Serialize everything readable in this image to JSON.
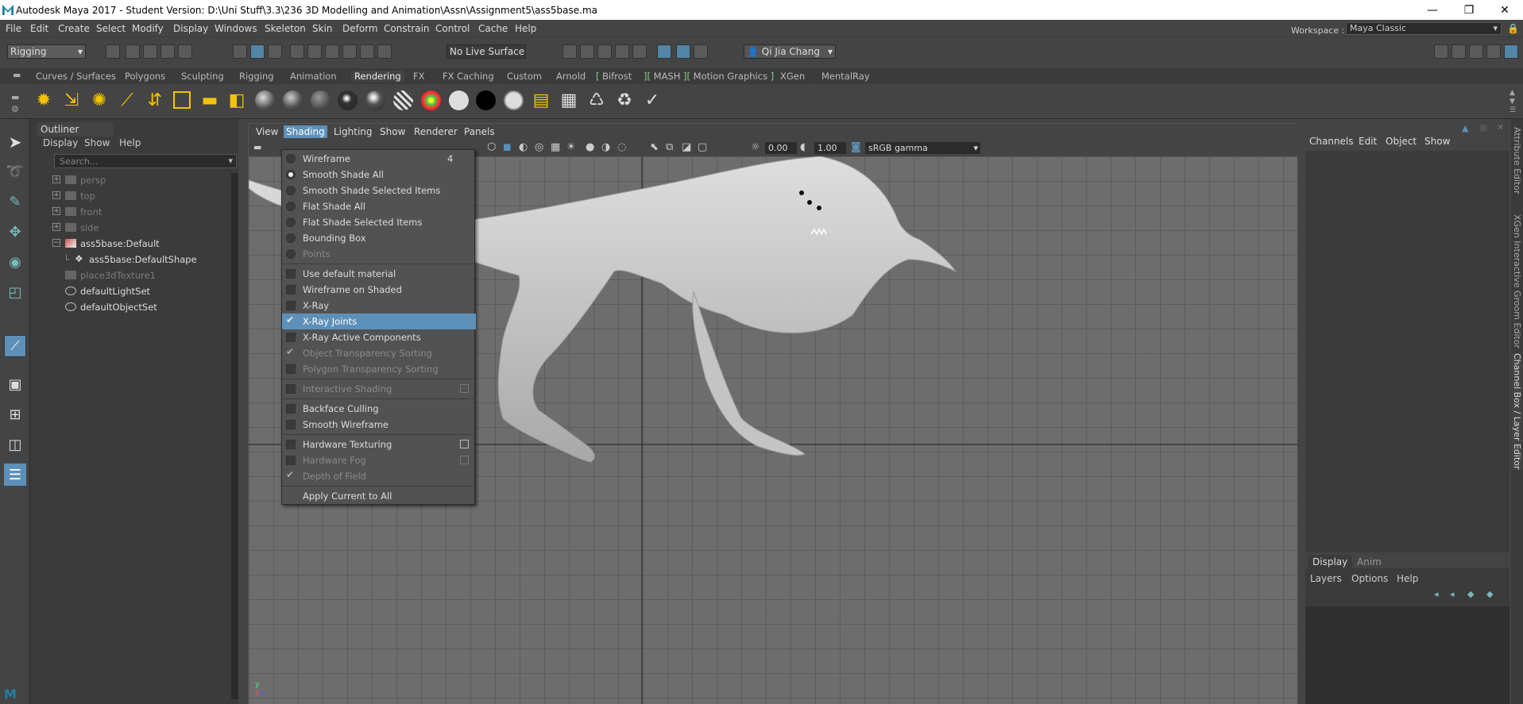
{
  "window": {
    "title": "Autodesk Maya 2017 - Student Version: D:\\Uni Stuff\\3.3\\236 3D Modelling and Animation\\Assn\\Assignment5\\ass5base.ma",
    "minimize_glyph": "—",
    "restore_glyph": "❐",
    "close_glyph": "✕"
  },
  "menubar": {
    "items": [
      "File",
      "Edit",
      "Create",
      "Select",
      "Modify",
      "Display",
      "Windows",
      "Skeleton",
      "Skin",
      "Deform",
      "Constrain",
      "Control",
      "Cache",
      "Help"
    ],
    "workspace_label": "Workspace :",
    "workspace_value": "Maya Classic"
  },
  "statusline": {
    "menuset": "Rigging",
    "live_surface": "No Live Surface",
    "user": "Qi Jia Chang"
  },
  "shelf": {
    "tabs": [
      "Curves / Surfaces",
      "Polygons",
      "Sculpting",
      "Rigging",
      "Animation",
      "Rendering",
      "FX",
      "FX Caching",
      "Custom",
      "Arnold",
      "Bifrost",
      "MASH",
      "Motion Graphics",
      "XGen",
      "MentalRay"
    ],
    "active_tab": "Rendering"
  },
  "outliner": {
    "title": "Outliner",
    "menu": [
      "Display",
      "Show",
      "Help"
    ],
    "search_placeholder": "Search...",
    "items": [
      {
        "label": "persp",
        "dim": true
      },
      {
        "label": "top",
        "dim": true
      },
      {
        "label": "front",
        "dim": true
      },
      {
        "label": "side",
        "dim": true
      },
      {
        "label": "ass5base:Default",
        "dim": false
      },
      {
        "label": "ass5base:DefaultShape",
        "dim": false
      },
      {
        "label": "place3dTexture1",
        "dim": true
      },
      {
        "label": "defaultLightSet",
        "dim": false
      },
      {
        "label": "defaultObjectSet",
        "dim": false
      }
    ]
  },
  "viewport": {
    "menu": [
      "View",
      "Shading",
      "Lighting",
      "Show",
      "Renderer",
      "Panels"
    ],
    "open_menu": "Shading",
    "exposure": "0.00",
    "gamma": "1.00",
    "color_space": "sRGB gamma"
  },
  "shading_menu": {
    "items": [
      {
        "label": "Wireframe",
        "mark": "radio",
        "on": false,
        "shortcut": "4"
      },
      {
        "label": "Smooth Shade All",
        "mark": "radio",
        "on": true
      },
      {
        "label": "Smooth Shade Selected Items",
        "mark": "radio",
        "on": false
      },
      {
        "label": "Flat Shade All",
        "mark": "radio",
        "on": false
      },
      {
        "label": "Flat Shade Selected Items",
        "mark": "radio",
        "on": false
      },
      {
        "label": "Bounding Box",
        "mark": "radio",
        "on": false
      },
      {
        "label": "Points",
        "mark": "radio",
        "on": false,
        "disabled": true
      },
      {
        "label": "Use default material",
        "mark": "box",
        "on": false
      },
      {
        "label": "Wireframe on Shaded",
        "mark": "box",
        "on": false
      },
      {
        "label": "X-Ray",
        "mark": "box",
        "on": false
      },
      {
        "label": "X-Ray Joints",
        "mark": "check",
        "on": true,
        "highlighted": true
      },
      {
        "label": "X-Ray Active Components",
        "mark": "box",
        "on": false
      },
      {
        "label": "Object Transparency Sorting",
        "mark": "check",
        "on": true,
        "disabled": true
      },
      {
        "label": "Polygon Transparency Sorting",
        "mark": "box",
        "on": false,
        "disabled": true
      },
      {
        "label": "Interactive Shading",
        "mark": "box",
        "on": false,
        "disabled": true,
        "options": true
      },
      {
        "label": "Backface Culling",
        "mark": "box",
        "on": false
      },
      {
        "label": "Smooth Wireframe",
        "mark": "box",
        "on": false
      },
      {
        "label": "Hardware Texturing",
        "mark": "box",
        "on": false,
        "options": true
      },
      {
        "label": "Hardware Fog",
        "mark": "box",
        "on": false,
        "disabled": true,
        "options": true
      },
      {
        "label": "Depth of Field",
        "mark": "check",
        "on": true,
        "disabled": true
      },
      {
        "label": "Apply Current to All",
        "mark": "none",
        "on": false
      }
    ]
  },
  "channel_box": {
    "menu": [
      "Channels",
      "Edit",
      "Object",
      "Show"
    ]
  },
  "layer_editor": {
    "tabs": [
      "Display",
      "Anim"
    ],
    "active_tab": "Display",
    "menu": [
      "Layers",
      "Options",
      "Help"
    ]
  },
  "side_tabs": [
    "Attribute Editor",
    "XGen Interactive Groom Editor",
    "Channel Box / Layer Editor"
  ],
  "colors": {
    "accent": "#5d90b9",
    "panel": "#444444",
    "background": "#3b3b3b"
  }
}
